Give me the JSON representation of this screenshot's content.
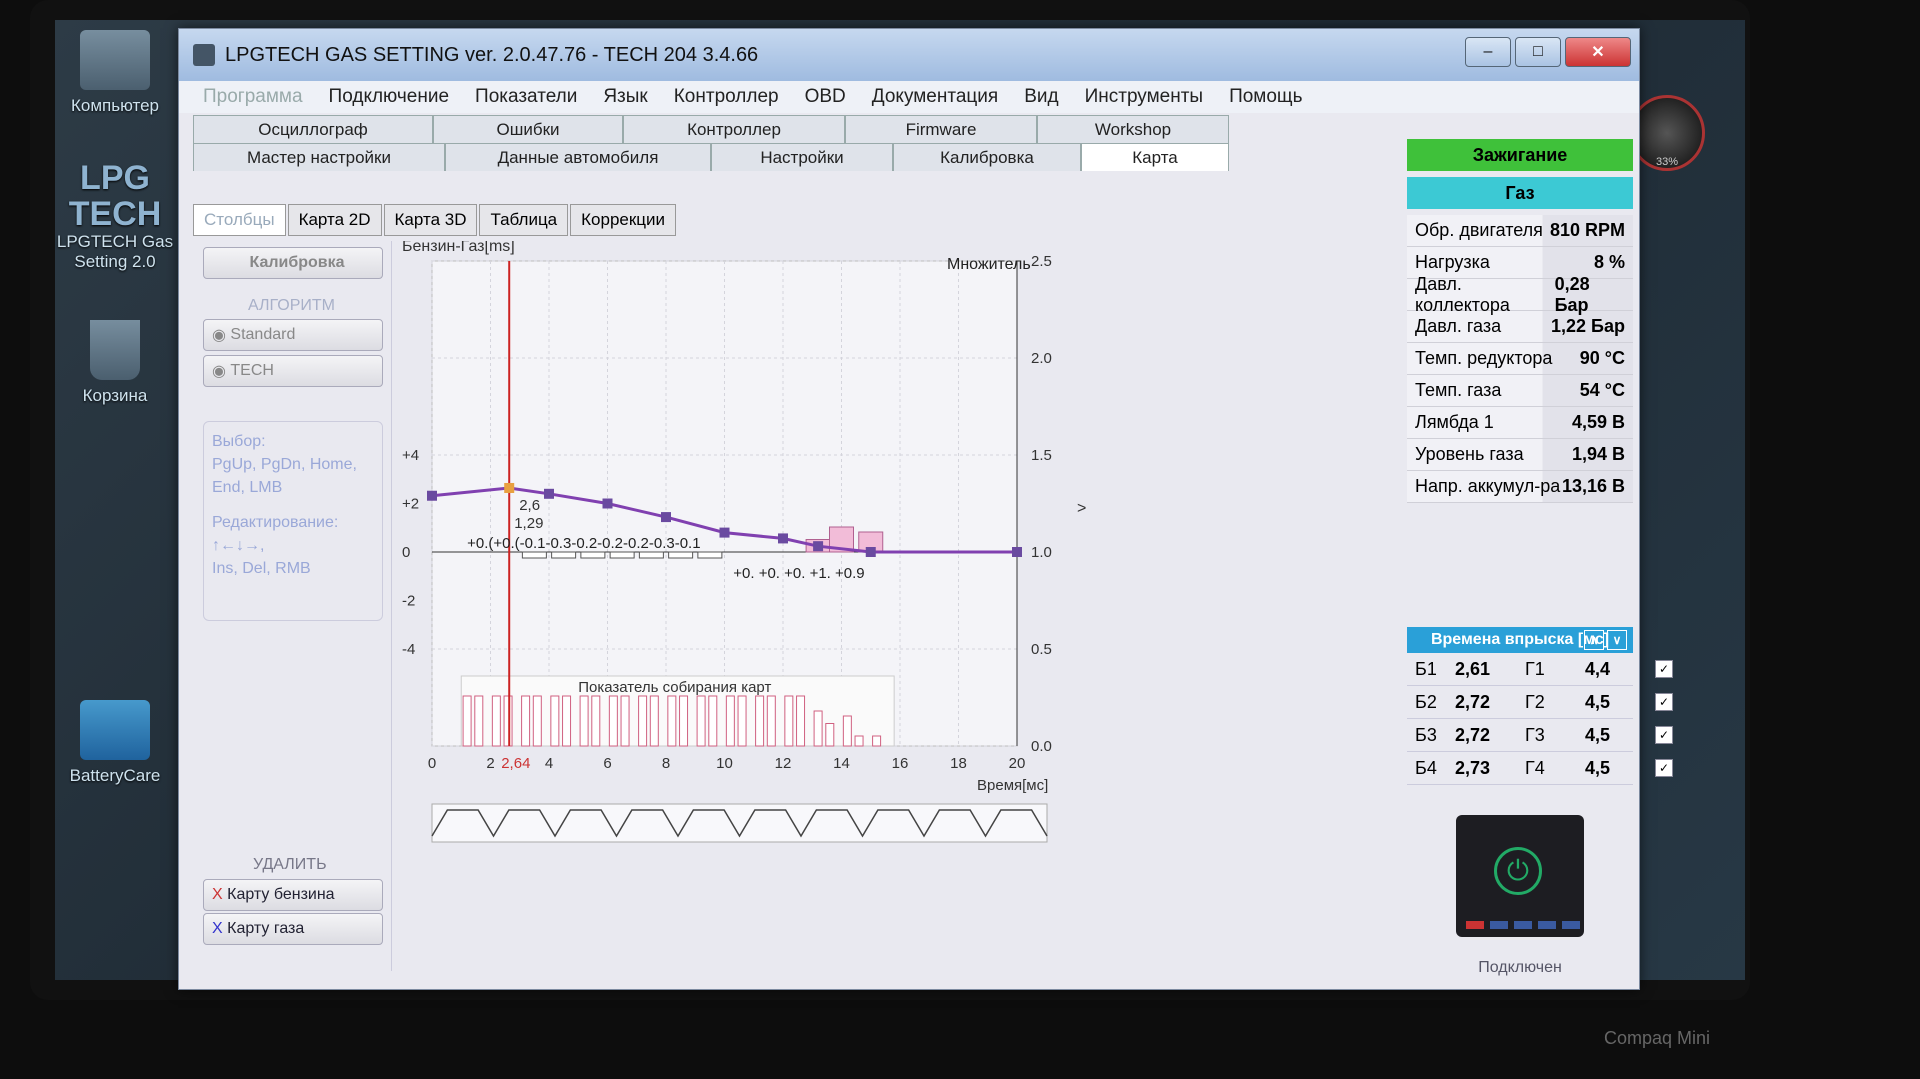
{
  "desktop": {
    "icons": [
      "Компьютер",
      "LPGTECH Gas Setting 2.0",
      "Корзина",
      "BatteryCare"
    ],
    "gauge_text": "33%",
    "logo_text": [
      "LPG",
      "TECH"
    ],
    "brand": "Compaq Mini"
  },
  "window": {
    "title": "LPGTECH GAS SETTING ver. 2.0.47.76  -  TECH 204   3.4.66",
    "menu": [
      "Программа",
      "Подключение",
      "Показатели",
      "Язык",
      "Контроллер",
      "OBD",
      "Документация",
      "Вид",
      "Инструменты",
      "Помощь"
    ]
  },
  "tabs_row1": [
    "Осциллограф",
    "Ошибки",
    "Контроллер",
    "Firmware",
    "Workshop"
  ],
  "tabs_row2": [
    "Мастер настройки",
    "Данные автомобиля",
    "Настройки",
    "Калибровка",
    "Карта"
  ],
  "subtabs": [
    "Столбцы",
    "Карта 2D",
    "Карта 3D",
    "Таблица",
    "Коррекции"
  ],
  "left": {
    "calib_button": "Калибровка",
    "algorithm_label": "АЛГОРИТМ",
    "algo_standard": "Standard",
    "algo_tech": "TECH",
    "help_select_title": "Выбор:",
    "help_select_keys": "PgUp, PgDn, Home, End, LMB",
    "help_edit_title": "Редактирование:",
    "help_edit_keys_1": "↑←↓→,",
    "help_edit_keys_2": "Ins, Del, RMB",
    "delete_label": "УДАЛИТЬ",
    "delete_petrol": "Карту бензина",
    "delete_gas": "Карту газа"
  },
  "chart": {
    "left_title": "Бензин-Газ[ms]",
    "right_title": "Множитель",
    "xlabel": "Время[мс]",
    "collect_label": "Показатель собирания карт",
    "cursor_x_label": "2,64",
    "point_label_1": "2,6",
    "point_label_2": "1,29",
    "upper_corr_labels": "+0.(+0.(-0.1-0.3-0.2-0.2-0.2-0.3-0.1",
    "lower_corr_labels": "+0. +0. +0. +1. +0.9",
    "right_arrow": ">"
  },
  "chart_data": {
    "type": "line",
    "x_ticks": [
      0,
      2,
      4,
      6,
      8,
      10,
      12,
      14,
      16,
      18,
      20
    ],
    "left_ticks": [
      "+4",
      "+2",
      "0",
      "-2",
      "-4"
    ],
    "right_ticks": [
      "2.5",
      "2.0",
      "1.5",
      "1.0",
      "0.5",
      "0.0"
    ],
    "ylim_right": [
      0.0,
      2.5
    ],
    "xlim": [
      0,
      20
    ],
    "multiplier_series": {
      "name": "Множитель",
      "x": [
        0,
        2.64,
        4,
        6,
        8,
        10,
        12,
        13.2,
        15,
        20
      ],
      "y": [
        1.29,
        1.33,
        1.3,
        1.25,
        1.18,
        1.1,
        1.07,
        1.03,
        1.0,
        1.0
      ]
    },
    "correction_bars": {
      "x": [
        13.2,
        14,
        15
      ],
      "values": [
        0.5,
        1.0,
        0.8
      ]
    },
    "collect_bars": {
      "x": [
        1.2,
        1.6,
        2.2,
        2.6,
        3.2,
        3.6,
        4.2,
        4.6,
        5.2,
        5.6,
        6.2,
        6.6,
        7.2,
        7.6,
        8.2,
        8.6,
        9.2,
        9.6,
        10.2,
        10.6,
        11.2,
        11.6,
        12.2,
        12.6,
        13.2,
        13.6,
        14.2,
        14.6,
        15.2
      ],
      "values": [
        1,
        1,
        1,
        1,
        1,
        1,
        1,
        1,
        1,
        1,
        1,
        1,
        1,
        1,
        1,
        1,
        1,
        1,
        1,
        1,
        1,
        1,
        1,
        1,
        0.7,
        0.45,
        0.6,
        0.2,
        0.2
      ]
    },
    "cursor_x": 2.64
  },
  "status": {
    "ignition": "Зажигание",
    "fuel": "Газ",
    "ignition_color": "#3fc13a",
    "fuel_color": "#3cc9d4"
  },
  "params": [
    {
      "name": "Обр. двигателя",
      "value": "810 RPM"
    },
    {
      "name": "Нагрузка",
      "value": "8 %"
    },
    {
      "name": "Давл. коллектора",
      "value": "0,28 Бар"
    },
    {
      "name": "Давл. газа",
      "value": "1,22 Бар"
    },
    {
      "name": "Темп. редуктора",
      "value": "90 °C"
    },
    {
      "name": "Темп. газа",
      "value": "54 °C"
    },
    {
      "name": "Лямбда 1",
      "value": "4,59 В"
    },
    {
      "name": "Уровень газа",
      "value": "1,94 В"
    },
    {
      "name": "Напр. аккумул-ра",
      "value": "13,16 В"
    }
  ],
  "injection": {
    "title": "Времена впрыска [мс]",
    "up": "∧",
    "down": "∨",
    "rows": [
      {
        "b": "Б1",
        "bv": "2,61",
        "g": "Г1",
        "gv": "4,4"
      },
      {
        "b": "Б2",
        "bv": "2,72",
        "g": "Г2",
        "gv": "4,5"
      },
      {
        "b": "Б3",
        "bv": "2,72",
        "g": "Г3",
        "gv": "4,5"
      },
      {
        "b": "Б4",
        "bv": "2,73",
        "g": "Г4",
        "gv": "4,5"
      }
    ],
    "check": "✓"
  },
  "connection": "Подключен"
}
